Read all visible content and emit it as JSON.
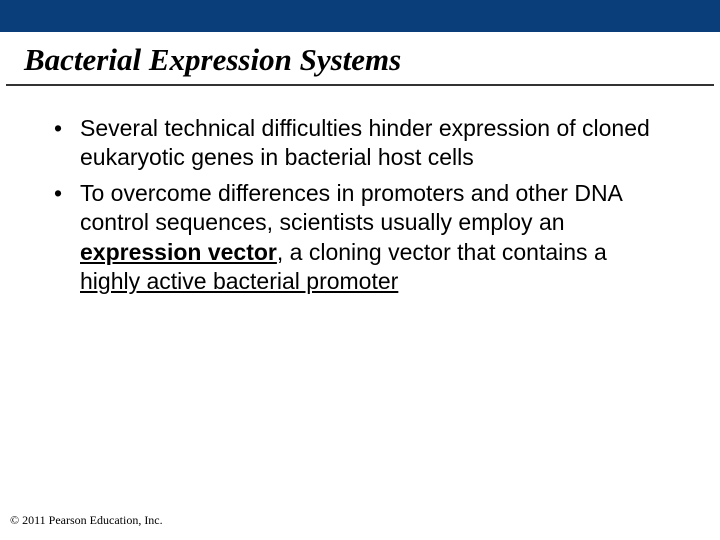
{
  "slide": {
    "title": "Bacterial Expression Systems",
    "bullets": [
      {
        "pre": "Several technical difficulties hinder expression of cloned eukaryotic genes in bacterial host cells"
      },
      {
        "pre": "To overcome differences in promoters and other DNA control sequences, scientists usually employ an ",
        "bold_underlined": "expression vector",
        "mid": ", a cloning vector that contains a ",
        "underlined": "highly active bacterial promoter"
      }
    ]
  },
  "footer": {
    "copyright": "© 2011 Pearson Education, Inc."
  }
}
